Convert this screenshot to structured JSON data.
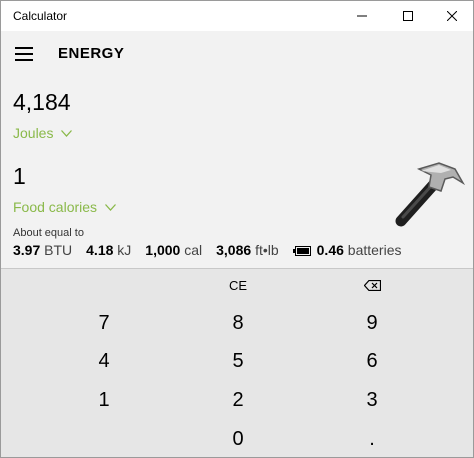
{
  "window": {
    "title": "Calculator"
  },
  "header": {
    "mode": "ENERGY"
  },
  "from": {
    "value": "4,184",
    "unit": "Joules"
  },
  "to": {
    "value": "1",
    "unit": "Food calories"
  },
  "about_label": "About equal to",
  "equivalents": [
    {
      "value": "3.97",
      "unit": "BTU"
    },
    {
      "value": "4.18",
      "unit": "kJ"
    },
    {
      "value": "1,000",
      "unit": "cal"
    },
    {
      "value": "3,086",
      "unit": "ft•lb"
    },
    {
      "value": "0.46",
      "unit": "batteries"
    }
  ],
  "keypad": {
    "ce": "CE",
    "k7": "7",
    "k8": "8",
    "k9": "9",
    "k4": "4",
    "k5": "5",
    "k6": "6",
    "k1": "1",
    "k2": "2",
    "k3": "3",
    "k0": "0",
    "dot": "."
  },
  "icons": {
    "menu": "hamburger-menu-icon",
    "dropdown": "chevron-down-icon",
    "backspace": "backspace-icon",
    "battery": "battery-icon",
    "logo": "hammer-logo"
  },
  "colors": {
    "accent": "#8ab94a",
    "keypad_bg": "#e6e6e6",
    "display_bg": "#f2f2f2"
  }
}
